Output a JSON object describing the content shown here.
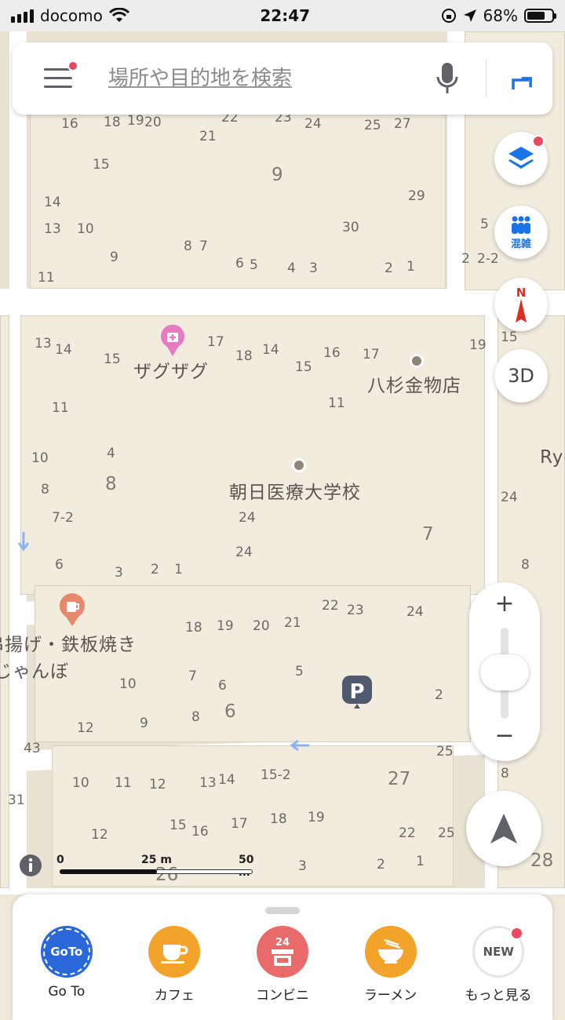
{
  "status_bar": {
    "carrier": "docomo",
    "time": "22:47",
    "battery_percent": "68%",
    "battery_level": 0.68
  },
  "search": {
    "placeholder": "場所や目的地を検索"
  },
  "map_controls": {
    "crowd_label": "混雑",
    "compass_label": "N",
    "view_3d_label": "3D",
    "zoom_in": "+",
    "zoom_out": "−"
  },
  "scale_bar": {
    "tick_0": "0",
    "tick_25": "25 m",
    "tick_50": "50 m"
  },
  "map_labels": {
    "zagu_zagu": "ザグザグ",
    "yasugi_kanamono": "八杉金物店",
    "asahi_iryo": "朝日医療大学校",
    "kushiage": "串揚げ・鉄板焼き",
    "janbo": "じゃんぼ",
    "ryo_partial": "Ryo"
  },
  "categories": [
    {
      "label": "Go To",
      "icon": "goto-badge-icon",
      "badge": "GoTo",
      "color": "#2a67d8"
    },
    {
      "label": "カフェ",
      "icon": "coffee-cup-icon",
      "color": "#f2a42a"
    },
    {
      "label": "コンビニ",
      "icon": "convenience-store-icon",
      "badge": "24",
      "color": "#e96a6a"
    },
    {
      "label": "ラーメン",
      "icon": "ramen-bowl-icon",
      "color": "#f2a42a"
    },
    {
      "label": "もっと見る",
      "icon": "new-badge-icon",
      "badge": "NEW",
      "color": "#ffffff"
    }
  ],
  "colors": {
    "accent": "#1a73e8",
    "notification": "#e84a5f",
    "map_background": "#efe9dc"
  }
}
